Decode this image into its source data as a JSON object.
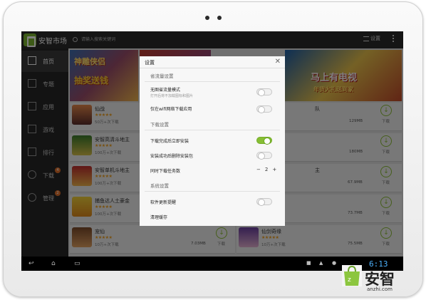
{
  "app": {
    "title": "安智市场"
  },
  "search": {
    "placeholder": "请输入搜索关键词"
  },
  "header": {
    "settings_label": "设置"
  },
  "sidebar": {
    "items": [
      {
        "label": "首页",
        "icon": "home-icon",
        "active": true
      },
      {
        "label": "专题",
        "icon": "topic-icon"
      },
      {
        "label": "应用",
        "icon": "apps-icon"
      },
      {
        "label": "游戏",
        "icon": "gamepad-icon"
      },
      {
        "label": "排行",
        "icon": "rank-icon"
      },
      {
        "label": "下载",
        "icon": "download-icon",
        "badge": "4"
      },
      {
        "label": "管理",
        "icon": "manage-icon",
        "badge": "2"
      }
    ]
  },
  "banners": {
    "left_title": "神雕侠侣",
    "left_sub": "抽奖送钱",
    "right_title": "马上有电视",
    "right_sub": "年货大礼送到家"
  },
  "apps_left": [
    {
      "name": "仙战",
      "downloads": "50万+次下载",
      "size": "",
      "dl_label": ""
    },
    {
      "name": "安智高清斗地主",
      "downloads": "100万+次下载",
      "size": "",
      "dl_label": ""
    },
    {
      "name": "安智单机斗地主",
      "downloads": "100万+次下载",
      "size": "",
      "dl_label": ""
    },
    {
      "name": "捕鱼达人土豪金",
      "downloads": "100万+次下载",
      "size": "",
      "dl_label": ""
    },
    {
      "name": "宠仙",
      "downloads": "10万+次下载",
      "size": "7.03MB",
      "dl_label": "下载"
    }
  ],
  "apps_right": [
    {
      "name": "队",
      "downloads": "",
      "size": "129MB",
      "dl_label": "下载"
    },
    {
      "name": "",
      "downloads": "",
      "size": "180MB",
      "dl_label": "下载"
    },
    {
      "name": "主",
      "downloads": "",
      "size": "67.9MB",
      "dl_label": "下载"
    },
    {
      "name": "",
      "downloads": "",
      "size": "73.7MB",
      "dl_label": "下载"
    },
    {
      "name": "仙剑奇缘",
      "downloads": "10万+次下载",
      "size": "75.5MB",
      "dl_label": "下载"
    }
  ],
  "dialog": {
    "title": "设置",
    "section_traffic": "省流量设置",
    "opt_no_image": "无图省流量模式",
    "opt_no_image_desc": "打开后将不加载图标和图片",
    "opt_no_image_on": false,
    "opt_wifi_only": "仅在wifi网络下载应用",
    "opt_wifi_only_on": false,
    "section_download": "下载设置",
    "opt_install_after": "下载完成后立即安装",
    "opt_install_after_on": true,
    "opt_delete_pkg": "安装成功后删除安装包",
    "opt_delete_pkg_on": false,
    "opt_concurrent": "同时下载任务数",
    "concurrent_minus": "−",
    "concurrent_value": "2",
    "concurrent_plus": "+",
    "section_system": "系统设置",
    "opt_update_notify": "软件更新提醒",
    "opt_update_notify_on": false,
    "opt_clear_cache": "清理缓存"
  },
  "status_bar": {
    "time": "6:13"
  },
  "brand": {
    "name": "安智",
    "url": "anzhi.com"
  }
}
